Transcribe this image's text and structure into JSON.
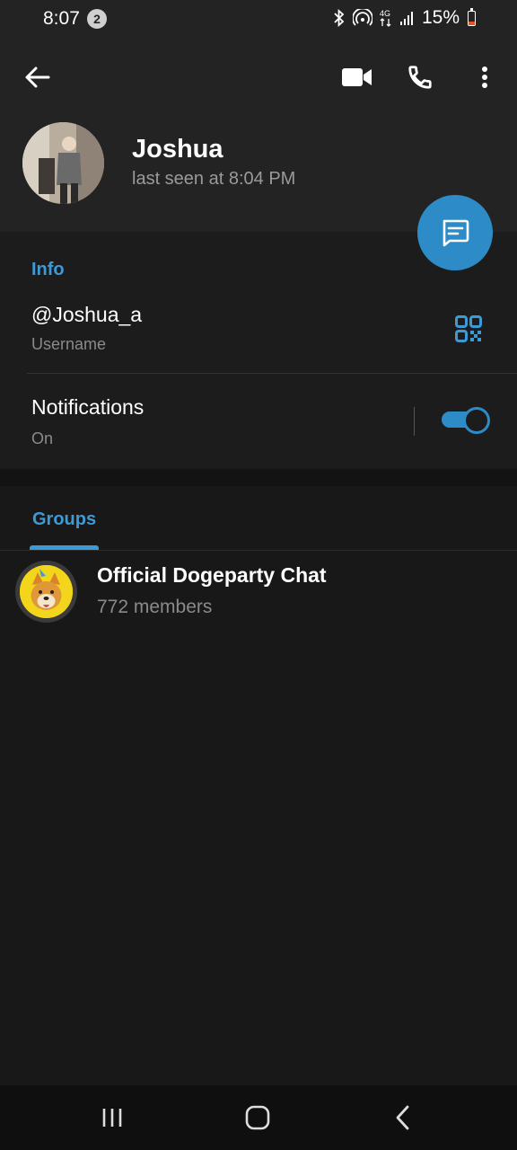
{
  "status_bar": {
    "time": "8:07",
    "notification_count": "2",
    "battery": "15%"
  },
  "profile": {
    "name": "Joshua",
    "last_seen": "last seen at 8:04 PM"
  },
  "info": {
    "section_title": "Info",
    "username_value": "@Joshua_a",
    "username_label": "Username",
    "notifications_label": "Notifications",
    "notifications_state": "On",
    "notifications_enabled": true
  },
  "groups": {
    "tab_label": "Groups",
    "items": [
      {
        "name": "Official Dogeparty Chat",
        "members": "772 members"
      }
    ]
  },
  "colors": {
    "accent": "#2d8cc7",
    "accent_text": "#3d9ad6",
    "background": "#181818",
    "header": "#232323"
  },
  "icons": [
    "back-arrow-icon",
    "video-call-icon",
    "phone-icon",
    "more-vertical-icon",
    "message-icon",
    "qr-code-icon",
    "recent-apps-icon",
    "home-icon",
    "back-nav-icon",
    "bluetooth-icon",
    "hotspot-icon",
    "signal-icon"
  ]
}
